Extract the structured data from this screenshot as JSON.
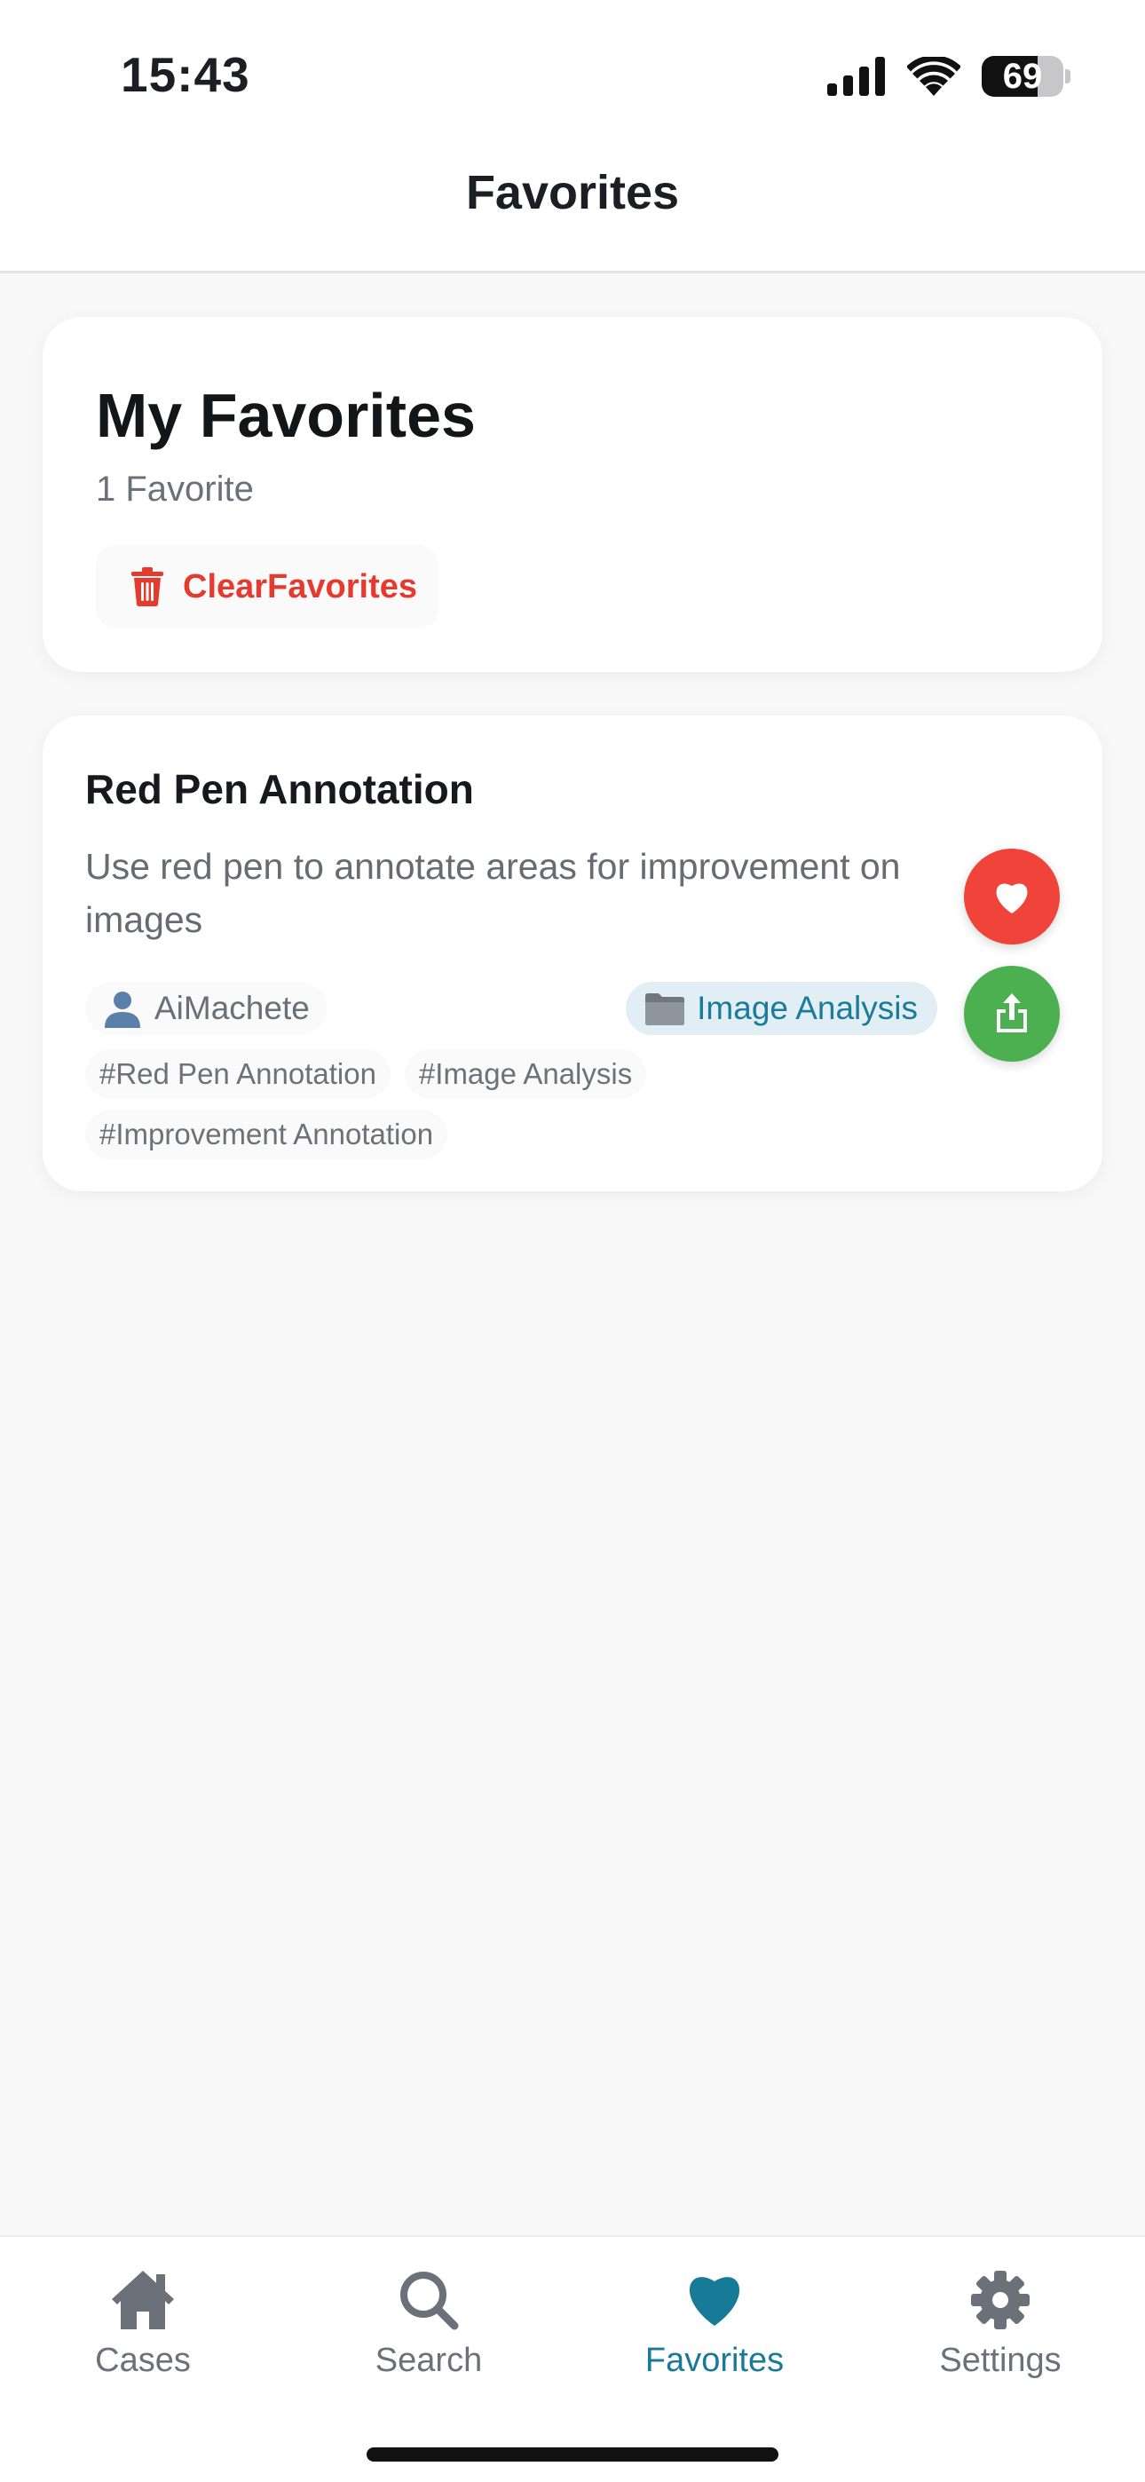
{
  "status": {
    "time": "15:43",
    "battery": "69",
    "battery_level": 0.69
  },
  "nav": {
    "title": "Favorites"
  },
  "header": {
    "title": "My Favorites",
    "count": "1 Favorite",
    "clear_label": "ClearFavorites"
  },
  "item": {
    "title": "Red Pen Annotation",
    "description": "Use red pen to annotate areas for improvement on images",
    "author": "AiMachete",
    "category": "Image Analysis",
    "tags": [
      "#Red Pen Annotation",
      "#Image Analysis",
      "#Improvement Annotation"
    ]
  },
  "tabs": [
    {
      "label": "Cases",
      "icon": "home-icon",
      "active": false
    },
    {
      "label": "Search",
      "icon": "search-icon",
      "active": false
    },
    {
      "label": "Favorites",
      "icon": "heart-icon",
      "active": true
    },
    {
      "label": "Settings",
      "icon": "gear-icon",
      "active": false
    }
  ],
  "colors": {
    "accent": "#177a97",
    "danger": "#e53b2f",
    "favorite": "#f0443a",
    "share": "#4caf50"
  }
}
